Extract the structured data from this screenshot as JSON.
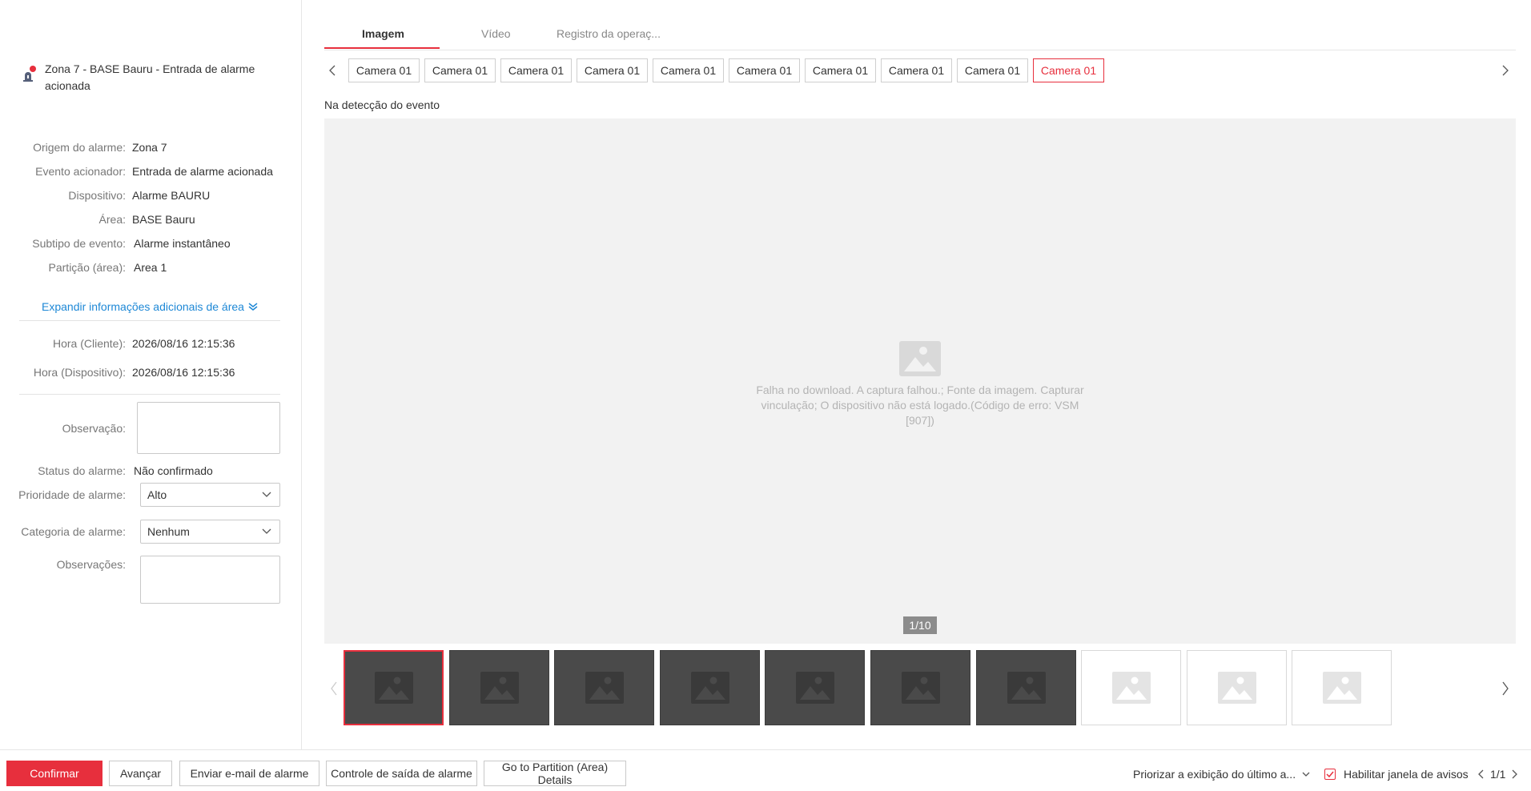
{
  "alarm": {
    "title_line1": "Zona 7 - BASE Bauru - Entrada de alarme",
    "title_line2": "acionada"
  },
  "details": [
    {
      "label": "Origem do alarme:",
      "value": "Zona 7"
    },
    {
      "label": "Evento acionador:",
      "value": "Entrada de alarme acionada"
    },
    {
      "label": "Dispositivo:",
      "value": "Alarme BAURU"
    },
    {
      "label": "Área:",
      "value": "BASE Bauru"
    },
    {
      "label": "Subtipo de evento:",
      "value": "Alarme instantâneo"
    },
    {
      "label": "Partição (área):",
      "value": "Area 1"
    }
  ],
  "expand_label": "Expandir informações adicionais de área",
  "times": [
    {
      "label": "Hora (Cliente):",
      "value": "2026/08/16 12:15:36"
    },
    {
      "label": "Hora (Dispositivo):",
      "value": "2026/08/16 12:15:36"
    }
  ],
  "form": {
    "observacao_label": "Observação:",
    "status_label": "Status do alarme:",
    "status_value": "Não confirmado",
    "priority_label": "Prioridade de alarme:",
    "priority_value": "Alto",
    "category_label": "Categoria de alarme:",
    "category_value": "Nenhum",
    "observacoes_label": "Observações:"
  },
  "tabs": [
    "Imagem",
    "Vídeo",
    "Registro da operaç..."
  ],
  "cameras": [
    "Camera 01",
    "Camera 01",
    "Camera 01",
    "Camera 01",
    "Camera 01",
    "Camera 01",
    "Camera 01",
    "Camera 01",
    "Camera 01",
    "Camera 01"
  ],
  "active_camera_index": 9,
  "event_label": "Na detecção do evento",
  "viewer": {
    "error_text": "Falha no download. A captura falhou.; Fonte da imagem. Capturar vinculação; O dispositivo não está logado.(Código de erro: VSM [907])",
    "page_indicator": "1/10"
  },
  "thumbnails": {
    "count": 10,
    "dark_count": 7,
    "selected_index": 0
  },
  "footer": {
    "confirm": "Confirmar",
    "next": "Avançar",
    "send_email": "Enviar e-mail de alarme",
    "output_control": "Controle de saída de alarme",
    "partition_details": "Go to Partition (Area) Details",
    "prioritize": "Priorizar a exibição do último a...",
    "enable_popup": "Habilitar janela de avisos",
    "pager": "1/1"
  },
  "colors": {
    "accent": "#e72f3d",
    "link": "#1e88d6"
  }
}
